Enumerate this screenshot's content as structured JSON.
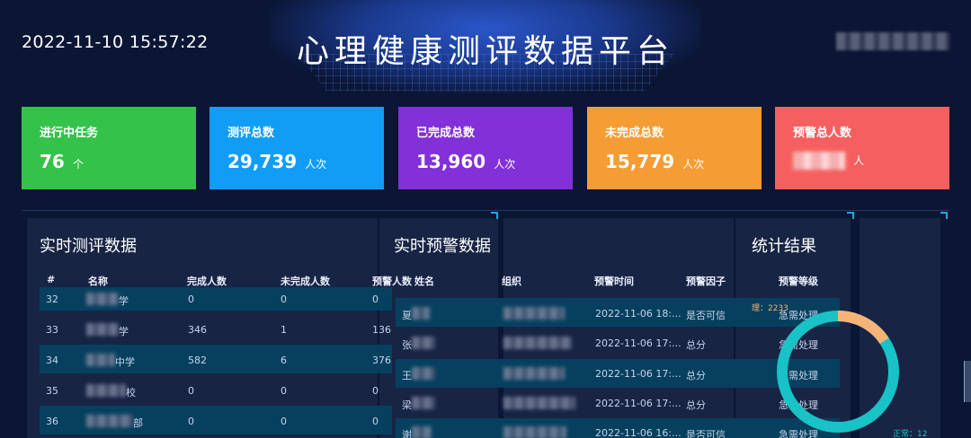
{
  "header": {
    "datetime": "2022-11-10 15:57:22",
    "title": "心理健康测评数据平台"
  },
  "cards": [
    {
      "label": "进行中任务",
      "value": "76",
      "unit": "个",
      "color": "#34c24a"
    },
    {
      "label": "测评总数",
      "value": "29,739",
      "unit": "人次",
      "color": "#119df5"
    },
    {
      "label": "已完成总数",
      "value": "13,960",
      "unit": "人次",
      "color": "#8230d8"
    },
    {
      "label": "未完成总数",
      "value": "15,779",
      "unit": "人次",
      "color": "#f59c34"
    },
    {
      "label": "预警总人数",
      "value": "",
      "unit": "人",
      "color": "#f65f5f"
    }
  ],
  "eval_section": {
    "title": "实时测评数据",
    "headers": [
      "#",
      "名称",
      "完成人数",
      "未完成人数",
      "预警人数"
    ],
    "rows": [
      {
        "no": "32",
        "name": "学",
        "done": "0",
        "undone": "0",
        "warn": "0"
      },
      {
        "no": "33",
        "name": "学",
        "done": "346",
        "undone": "1",
        "warn": "136"
      },
      {
        "no": "34",
        "name": "中学",
        "done": "582",
        "undone": "6",
        "warn": "376"
      },
      {
        "no": "35",
        "name": "校",
        "done": "0",
        "undone": "0",
        "warn": "0"
      },
      {
        "no": "36",
        "name": "部",
        "done": "0",
        "undone": "0",
        "warn": "0"
      }
    ]
  },
  "warn_section": {
    "title": "实时预警数据",
    "headers": [
      "姓名",
      "组织",
      "预警时间",
      "预警因子",
      "预警等级"
    ],
    "rows": [
      {
        "name": "夏",
        "time": "2022-11-06 18:...",
        "factor": "是否可信",
        "level": "急需处理"
      },
      {
        "name": "张",
        "time": "2022-11-06 17:...",
        "factor": "总分",
        "level": "急需处理"
      },
      {
        "name": "王",
        "time": "2022-11-06 17:...",
        "factor": "总分",
        "level": "急需处理"
      },
      {
        "name": "梁",
        "time": "2022-11-06 17:...",
        "factor": "总分",
        "level": "急需处理"
      },
      {
        "name": "谢",
        "time": "2022-11-06 16:...",
        "factor": "是否可信",
        "level": "急需处理"
      }
    ]
  },
  "stats_section": {
    "title": "统计结果",
    "legend_top": "理：2233",
    "legend_bottom": "正常：12"
  },
  "chart_data": {
    "type": "pie",
    "values": [
      2233,
      12000
    ],
    "colors": [
      "#f5b37a",
      "#18c2c6"
    ]
  }
}
